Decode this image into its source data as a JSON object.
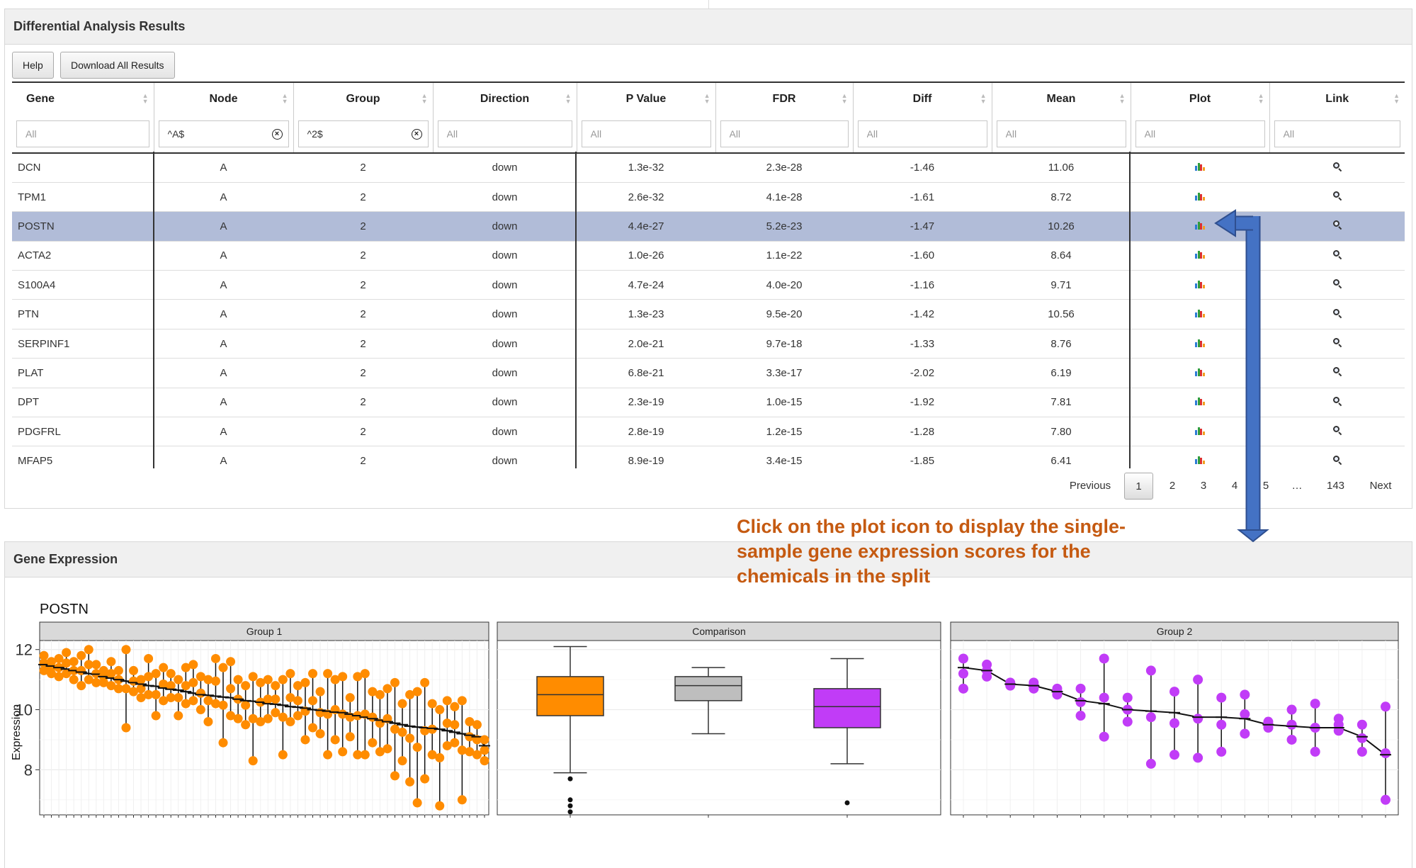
{
  "panels": {
    "results_title": "Differential Analysis Results",
    "expression_title": "Gene Expression"
  },
  "toolbar": {
    "help_label": "Help",
    "download_label": "Download All Results"
  },
  "table": {
    "columns": [
      "Gene",
      "Node",
      "Group",
      "Direction",
      "P Value",
      "FDR",
      "Diff",
      "Mean",
      "Plot",
      "Link"
    ],
    "filters": [
      {
        "value": "",
        "placeholder": "All"
      },
      {
        "value": "^A$",
        "placeholder": "All"
      },
      {
        "value": "^2$",
        "placeholder": "All"
      },
      {
        "value": "",
        "placeholder": "All"
      },
      {
        "value": "",
        "placeholder": "All"
      },
      {
        "value": "",
        "placeholder": "All"
      },
      {
        "value": "",
        "placeholder": "All"
      },
      {
        "value": "",
        "placeholder": "All"
      },
      {
        "value": "",
        "placeholder": "All"
      },
      {
        "value": "",
        "placeholder": "All"
      }
    ],
    "rows": [
      {
        "gene": "DCN",
        "node": "A",
        "group": "2",
        "direction": "down",
        "pvalue": "1.3e-32",
        "fdr": "2.3e-28",
        "diff": "-1.46",
        "mean": "11.06"
      },
      {
        "gene": "TPM1",
        "node": "A",
        "group": "2",
        "direction": "down",
        "pvalue": "2.6e-32",
        "fdr": "4.1e-28",
        "diff": "-1.61",
        "mean": "8.72"
      },
      {
        "gene": "POSTN",
        "node": "A",
        "group": "2",
        "direction": "down",
        "pvalue": "4.4e-27",
        "fdr": "5.2e-23",
        "diff": "-1.47",
        "mean": "10.26"
      },
      {
        "gene": "ACTA2",
        "node": "A",
        "group": "2",
        "direction": "down",
        "pvalue": "1.0e-26",
        "fdr": "1.1e-22",
        "diff": "-1.60",
        "mean": "8.64"
      },
      {
        "gene": "S100A4",
        "node": "A",
        "group": "2",
        "direction": "down",
        "pvalue": "4.7e-24",
        "fdr": "4.0e-20",
        "diff": "-1.16",
        "mean": "9.71"
      },
      {
        "gene": "PTN",
        "node": "A",
        "group": "2",
        "direction": "down",
        "pvalue": "1.3e-23",
        "fdr": "9.5e-20",
        "diff": "-1.42",
        "mean": "10.56"
      },
      {
        "gene": "SERPINF1",
        "node": "A",
        "group": "2",
        "direction": "down",
        "pvalue": "2.0e-21",
        "fdr": "9.7e-18",
        "diff": "-1.33",
        "mean": "8.76"
      },
      {
        "gene": "PLAT",
        "node": "A",
        "group": "2",
        "direction": "down",
        "pvalue": "6.8e-21",
        "fdr": "3.3e-17",
        "diff": "-2.02",
        "mean": "6.19"
      },
      {
        "gene": "DPT",
        "node": "A",
        "group": "2",
        "direction": "down",
        "pvalue": "2.3e-19",
        "fdr": "1.0e-15",
        "diff": "-1.92",
        "mean": "7.81"
      },
      {
        "gene": "PDGFRL",
        "node": "A",
        "group": "2",
        "direction": "down",
        "pvalue": "2.8e-19",
        "fdr": "1.2e-15",
        "diff": "-1.28",
        "mean": "7.80"
      },
      {
        "gene": "MFAP5",
        "node": "A",
        "group": "2",
        "direction": "down",
        "pvalue": "8.9e-19",
        "fdr": "3.4e-15",
        "diff": "-1.85",
        "mean": "6.41"
      }
    ],
    "selected_row": 2
  },
  "pagination": {
    "previous": "Previous",
    "pages": [
      "1",
      "2",
      "3",
      "4",
      "5",
      "…",
      "143"
    ],
    "current": "1",
    "next": "Next"
  },
  "annotation": "Click on the plot icon to display the single-sample gene expression scores for the chemicals in the split",
  "plot": {
    "gene_title": "POSTN",
    "facets": [
      "Group 1",
      "Comparison",
      "Group 2"
    ],
    "ylabel": "Expression",
    "yticks": [
      "12",
      "10",
      "8"
    ]
  },
  "colors": {
    "orange": "#ff8c00",
    "grey": "#bebebe",
    "purple": "#c13cf7",
    "selected_row": "#b1bcd8",
    "annotation_text": "#c55a11",
    "arrow": "#4472c4"
  },
  "chart_data": [
    {
      "type": "scatter",
      "title": "Group 1",
      "ylabel": "Expression",
      "ylim": [
        6.5,
        12.3
      ],
      "note_value_sets": "per-sample points with vertical range lines; 60 samples sorted by decreasing median",
      "medians": [
        11.5,
        11.45,
        11.4,
        11.35,
        11.3,
        11.25,
        11.2,
        11.18,
        11.1,
        11.05,
        11.0,
        10.95,
        10.9,
        10.85,
        10.8,
        10.78,
        10.72,
        10.68,
        10.65,
        10.6,
        10.55,
        10.5,
        10.48,
        10.45,
        10.42,
        10.4,
        10.35,
        10.3,
        10.28,
        10.25,
        10.2,
        10.18,
        10.15,
        10.1,
        10.08,
        10.05,
        10.0,
        9.98,
        9.95,
        9.92,
        9.9,
        9.85,
        9.8,
        9.75,
        9.7,
        9.65,
        9.6,
        9.55,
        9.5,
        9.45,
        9.42,
        9.4,
        9.38,
        9.35,
        9.3,
        9.25,
        9.2,
        9.15,
        9.1,
        8.8
      ],
      "lows": [
        11.3,
        11.2,
        11.1,
        11.2,
        11.0,
        10.8,
        11.0,
        10.9,
        10.9,
        10.8,
        10.7,
        9.4,
        10.6,
        10.4,
        10.5,
        9.8,
        10.3,
        10.4,
        9.8,
        10.2,
        10.3,
        10.0,
        9.6,
        10.2,
        8.9,
        9.8,
        9.7,
        9.5,
        8.3,
        9.6,
        9.7,
        9.9,
        8.5,
        9.6,
        9.8,
        9.0,
        9.4,
        9.2,
        8.5,
        9.0,
        8.6,
        9.1,
        8.5,
        8.5,
        8.9,
        8.6,
        8.7,
        7.8,
        8.3,
        7.6,
        6.9,
        7.7,
        8.5,
        6.8,
        8.8,
        8.9,
        7.0,
        8.6,
        8.5,
        8.3
      ],
      "highs": [
        11.8,
        11.6,
        11.7,
        11.9,
        11.6,
        11.8,
        12.0,
        11.5,
        11.3,
        11.6,
        11.3,
        12.0,
        11.3,
        11.0,
        11.7,
        11.2,
        11.4,
        11.2,
        11.0,
        11.4,
        11.5,
        11.1,
        11.0,
        11.7,
        11.4,
        11.6,
        11.0,
        10.8,
        11.1,
        10.9,
        11.0,
        10.8,
        11.0,
        11.2,
        10.8,
        10.9,
        11.2,
        10.6,
        11.2,
        11.0,
        11.1,
        10.4,
        11.1,
        11.2,
        10.6,
        10.5,
        10.7,
        10.9,
        10.2,
        10.5,
        10.6,
        10.9,
        10.2,
        10.0,
        10.3,
        10.1,
        10.3,
        9.6,
        9.5,
        9.0
      ]
    },
    {
      "type": "box",
      "title": "Comparison",
      "ylim": [
        6.5,
        12.3
      ],
      "series": [
        {
          "color": "#ff8c00",
          "min": 7.9,
          "q1": 9.8,
          "median": 10.5,
          "q3": 11.1,
          "max": 12.1,
          "outliers": [
            7.7,
            7.0,
            6.8,
            6.6
          ]
        },
        {
          "color": "#bebebe",
          "min": 9.2,
          "q1": 10.3,
          "median": 10.8,
          "q3": 11.1,
          "max": 11.4,
          "outliers": []
        },
        {
          "color": "#c13cf7",
          "min": 8.2,
          "q1": 9.4,
          "median": 10.1,
          "q3": 10.7,
          "max": 11.7,
          "outliers": [
            6.9
          ]
        }
      ]
    },
    {
      "type": "scatter",
      "title": "Group 2",
      "ylim": [
        6.5,
        12.3
      ],
      "note_value_sets": "per-sample points with vertical range lines; 19 samples",
      "medians": [
        11.4,
        11.3,
        10.85,
        10.8,
        10.6,
        10.3,
        10.2,
        10.0,
        9.95,
        9.9,
        9.75,
        9.75,
        9.7,
        9.5,
        9.45,
        9.4,
        9.4,
        9.1,
        8.5
      ],
      "lows": [
        10.7,
        11.1,
        10.8,
        10.7,
        10.5,
        9.8,
        9.1,
        9.6,
        8.2,
        8.5,
        8.4,
        8.6,
        9.2,
        9.4,
        9.0,
        8.6,
        9.3,
        8.6,
        7.0
      ],
      "highs": [
        11.7,
        11.5,
        10.9,
        10.9,
        10.7,
        10.7,
        11.7,
        10.4,
        11.3,
        10.6,
        11.0,
        10.4,
        10.5,
        9.6,
        10.0,
        10.2,
        9.7,
        9.5,
        10.1
      ]
    }
  ]
}
